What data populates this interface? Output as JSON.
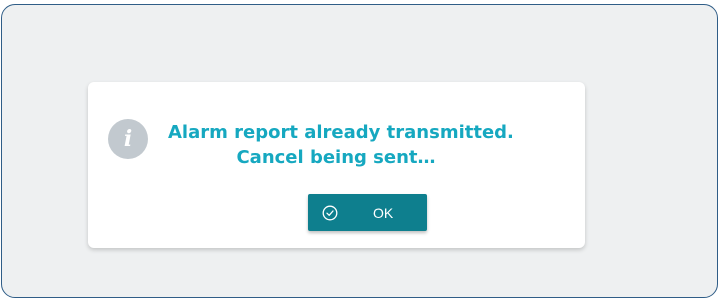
{
  "dialog": {
    "icon": "info-icon",
    "icon_glyph": "i",
    "message_line1": "Alarm report already transmitted.",
    "message_line2": "Cancel being sent…",
    "ok_label": "OK",
    "ok_icon": "check-circle-icon"
  },
  "colors": {
    "frame_border": "#2f5d87",
    "frame_background": "#eef0f1",
    "message_text": "#16a8c0",
    "button_background": "#0e7f8e",
    "info_icon_background": "#c2c9cf"
  }
}
